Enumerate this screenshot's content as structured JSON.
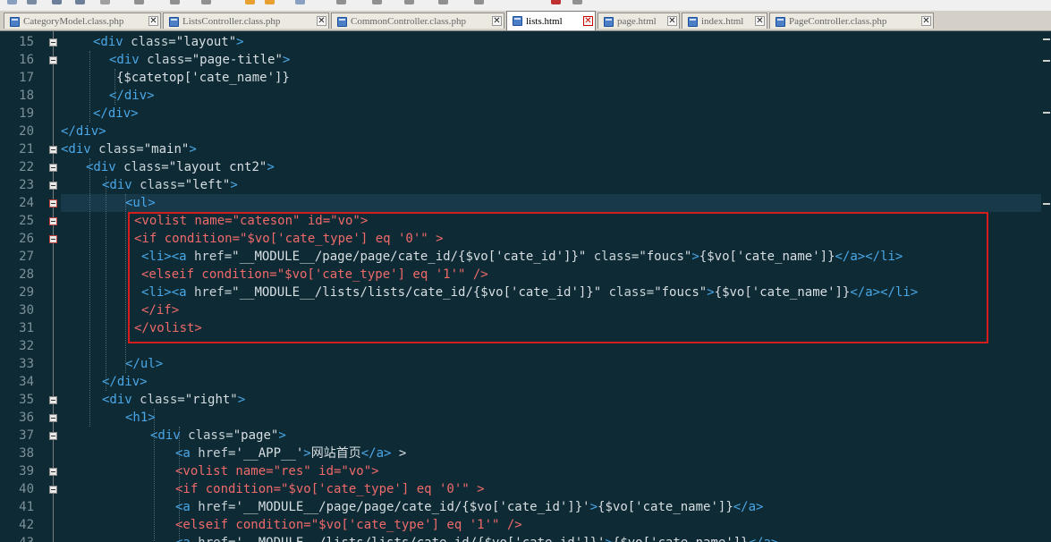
{
  "tabs": [
    {
      "label": "CategoryModel.class.php",
      "active": false
    },
    {
      "label": "ListsController.class.php",
      "active": false
    },
    {
      "label": "CommonController.class.php",
      "active": false
    },
    {
      "label": "lists.html",
      "active": true
    },
    {
      "label": "page.html",
      "active": false
    },
    {
      "label": "index.html",
      "active": false
    },
    {
      "label": "PageController.class.php",
      "active": false
    }
  ],
  "editor": {
    "current_line": 24,
    "highlighted_lines": [
      25,
      31
    ],
    "lines": [
      {
        "n": 15,
        "segs": [
          [
            "t",
            "<div"
          ],
          [
            "a",
            " class="
          ],
          [
            "s",
            "\"layout\""
          ],
          [
            "t",
            ">"
          ]
        ]
      },
      {
        "n": 16,
        "segs": [
          [
            "t",
            "<div"
          ],
          [
            "a",
            " class="
          ],
          [
            "s",
            "\"page-title\""
          ],
          [
            "t",
            ">"
          ]
        ]
      },
      {
        "n": 17,
        "segs": [
          [
            "x",
            "{$catetop['cate_name']}"
          ]
        ]
      },
      {
        "n": 18,
        "segs": [
          [
            "t",
            "</div>"
          ]
        ]
      },
      {
        "n": 19,
        "segs": [
          [
            "t",
            "</div>"
          ]
        ]
      },
      {
        "n": 20,
        "segs": [
          [
            "t",
            "</div>"
          ]
        ]
      },
      {
        "n": 21,
        "segs": [
          [
            "t",
            "<div"
          ],
          [
            "a",
            " class="
          ],
          [
            "s",
            "\"main\""
          ],
          [
            "t",
            ">"
          ]
        ]
      },
      {
        "n": 22,
        "segs": [
          [
            "t",
            "<div"
          ],
          [
            "a",
            " class="
          ],
          [
            "s",
            "\"layout cnt2\""
          ],
          [
            "t",
            ">"
          ]
        ]
      },
      {
        "n": 23,
        "segs": [
          [
            "t",
            "<div"
          ],
          [
            "a",
            " class="
          ],
          [
            "s",
            "\"left\""
          ],
          [
            "t",
            ">"
          ]
        ]
      },
      {
        "n": 24,
        "segs": [
          [
            "t",
            "<ul>"
          ]
        ]
      },
      {
        "n": 25,
        "segs": [
          [
            "r",
            "<volist name=\"cateson\" id=\"vo\">"
          ]
        ]
      },
      {
        "n": 26,
        "segs": [
          [
            "r",
            "<if condition=\"$vo['cate_type'] eq '0'\" >"
          ]
        ]
      },
      {
        "n": 27,
        "segs": [
          [
            "t",
            "<li><a"
          ],
          [
            "a",
            " href="
          ],
          [
            "s",
            "\"__MODULE__/page/page/cate_id/{$vo['cate_id']}\""
          ],
          [
            "a",
            " class="
          ],
          [
            "s",
            "\"foucs\""
          ],
          [
            "t",
            ">"
          ],
          [
            "x",
            "{$vo['cate_name']}"
          ],
          [
            "t",
            "</a></li>"
          ]
        ]
      },
      {
        "n": 28,
        "segs": [
          [
            "r",
            "<elseif condition=\"$vo['cate_type'] eq '1'\" />"
          ]
        ]
      },
      {
        "n": 29,
        "segs": [
          [
            "t",
            "<li><a"
          ],
          [
            "a",
            " href="
          ],
          [
            "s",
            "\"__MODULE__/lists/lists/cate_id/{$vo['cate_id']}\""
          ],
          [
            "a",
            " class="
          ],
          [
            "s",
            "\"foucs\""
          ],
          [
            "t",
            ">"
          ],
          [
            "x",
            "{$vo['cate_name']}"
          ],
          [
            "t",
            "</a></li>"
          ]
        ]
      },
      {
        "n": 30,
        "segs": [
          [
            "r",
            "</if>"
          ]
        ]
      },
      {
        "n": 31,
        "segs": [
          [
            "r",
            "</volist>"
          ]
        ]
      },
      {
        "n": 32,
        "segs": []
      },
      {
        "n": 33,
        "segs": [
          [
            "t",
            "</ul>"
          ]
        ]
      },
      {
        "n": 34,
        "segs": [
          [
            "t",
            "</div>"
          ]
        ]
      },
      {
        "n": 35,
        "segs": [
          [
            "t",
            "<div"
          ],
          [
            "a",
            " class="
          ],
          [
            "s",
            "\"right\""
          ],
          [
            "t",
            ">"
          ]
        ]
      },
      {
        "n": 36,
        "segs": [
          [
            "t",
            "<h1>"
          ]
        ]
      },
      {
        "n": 37,
        "segs": [
          [
            "t",
            "<div"
          ],
          [
            "a",
            " class="
          ],
          [
            "s",
            "\"page\""
          ],
          [
            "t",
            ">"
          ]
        ]
      },
      {
        "n": 38,
        "segs": [
          [
            "t",
            "<a"
          ],
          [
            "a",
            " href="
          ],
          [
            "s",
            "'__APP__'"
          ],
          [
            "t",
            ">"
          ],
          [
            "x",
            "网站首页"
          ],
          [
            "t",
            "</a>"
          ],
          [
            "x",
            " >"
          ]
        ]
      },
      {
        "n": 39,
        "segs": [
          [
            "r",
            "<volist name=\"res\" id=\"vo\">"
          ]
        ]
      },
      {
        "n": 40,
        "segs": [
          [
            "r",
            "<if condition=\"$vo['cate_type'] eq '0'\" >"
          ]
        ]
      },
      {
        "n": 41,
        "segs": [
          [
            "t",
            "<a"
          ],
          [
            "a",
            " href="
          ],
          [
            "s",
            "'__MODULE__/page/page/cate_id/{$vo['cate_id']}'"
          ],
          [
            "t",
            ">"
          ],
          [
            "x",
            "{$vo['cate_name']}"
          ],
          [
            "t",
            "</a>"
          ]
        ]
      },
      {
        "n": 42,
        "segs": [
          [
            "r",
            "<elseif condition=\"$vo['cate_type'] eq '1'\" />"
          ]
        ]
      },
      {
        "n": 43,
        "segs": [
          [
            "t",
            "<a"
          ],
          [
            "a",
            " href="
          ],
          [
            "s",
            "'__MODULE__/lists/lists/cate_id/{$vo['cate_id']}'"
          ],
          [
            "t",
            ">"
          ],
          [
            "x",
            "{$vo['cate_name']}"
          ],
          [
            "t",
            "</a>"
          ]
        ]
      }
    ]
  }
}
